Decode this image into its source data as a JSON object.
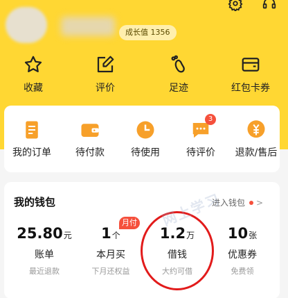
{
  "profile": {
    "growth_value": "成长值 1356"
  },
  "quick_actions": [
    {
      "label": "收藏",
      "icon": "star-icon"
    },
    {
      "label": "评价",
      "icon": "edit-icon"
    },
    {
      "label": "足迹",
      "icon": "footprint-icon"
    },
    {
      "label": "红包卡券",
      "icon": "coupon-wallet-icon"
    }
  ],
  "orders": [
    {
      "label": "我的订单",
      "icon": "order-list-icon"
    },
    {
      "label": "待付款",
      "icon": "wallet-icon"
    },
    {
      "label": "待使用",
      "icon": "clock-icon"
    },
    {
      "label": "待评价",
      "icon": "comment-icon",
      "badge": "3"
    },
    {
      "label": "退款/售后",
      "icon": "refund-icon"
    }
  ],
  "wallet": {
    "title": "我的钱包",
    "enter_label": "进入钱包",
    "chevron": ">",
    "month_tag": "月付",
    "watermark": "网上学习",
    "stats": [
      {
        "value": "25.80",
        "unit": "元",
        "label": "账单",
        "sub": "最近退款"
      },
      {
        "value": "1",
        "unit": "个",
        "label": "本月买",
        "sub": "下月还权益"
      },
      {
        "value": "1.2",
        "unit": "万",
        "label": "借钱",
        "sub": "大约可借"
      },
      {
        "value": "10",
        "unit": "张",
        "label": "优惠券",
        "sub": "免费领"
      }
    ]
  },
  "colors": {
    "header_bg": "#ffd733",
    "accent_orange": "#f7a02a",
    "badge_red": "#f5503c",
    "circle_red": "#e21b1b"
  }
}
